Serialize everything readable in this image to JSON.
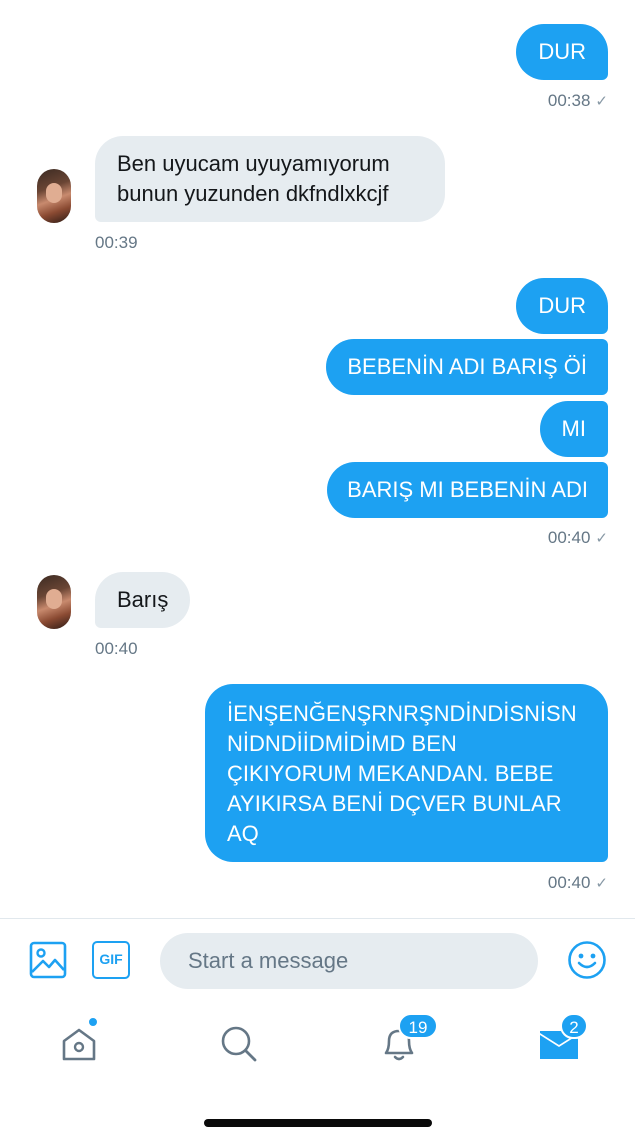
{
  "messages": {
    "m1": {
      "text": "DUR",
      "time": "00:38"
    },
    "m2": {
      "text": "Ben uyucam uyuyamıyorum bunun yuzunden dkfndlxkcjf",
      "time": "00:39"
    },
    "m3": {
      "text": "DUR"
    },
    "m4": {
      "text": "BEBENİN ADI BARIŞ Öİ"
    },
    "m5": {
      "text": "MI"
    },
    "m6": {
      "text": "BARIŞ MI BEBENİN ADI",
      "time": "00:40"
    },
    "m7": {
      "text": "Barış",
      "time": "00:40"
    },
    "m8": {
      "text": "İENŞENĞENŞRNRŞNDİNDİSNİSN NİDNDİİDMİDİMD BEN ÇIKIYORUM MEKANDAN. BEBE AYIKIRSA BENİ DÇVER BUNLAR AQ",
      "time": "00:40"
    }
  },
  "check_mark": "✓",
  "composer": {
    "placeholder": "Start a message",
    "gif_label": "GIF"
  },
  "tabbar": {
    "notifications_count": "19",
    "messages_count": "2"
  },
  "colors": {
    "accent": "#1da1f2",
    "incoming_bubble": "#e6ecf0",
    "timestamp": "#657786"
  },
  "icons": [
    "image-icon",
    "gif-icon",
    "emoji-icon",
    "home-icon",
    "search-icon",
    "bell-icon",
    "mail-icon",
    "avatar"
  ]
}
